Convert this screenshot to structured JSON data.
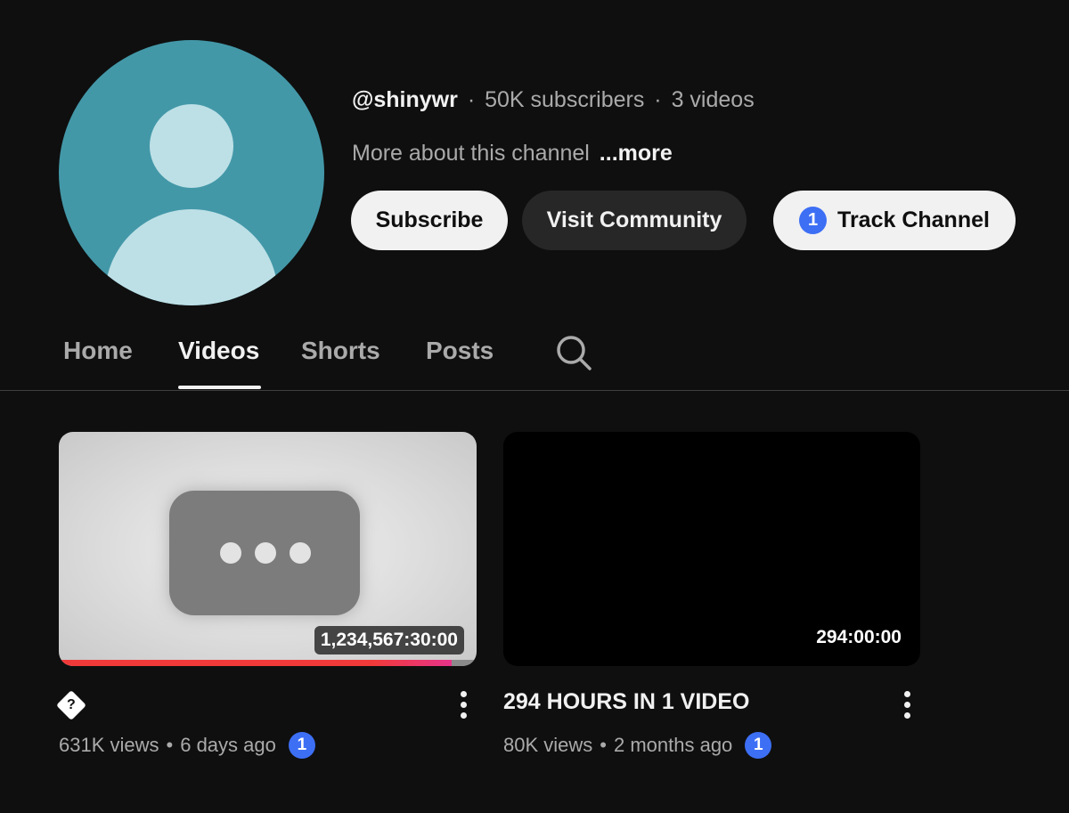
{
  "channel": {
    "handle": "@shinywr",
    "subscribers": "50K subscribers",
    "video_count": "3 videos",
    "separator": "·",
    "about": "More about this channel",
    "more_label": "...more",
    "avatar_color": "#4398a8",
    "avatar_icon": "default-person-avatar"
  },
  "buttons": {
    "subscribe": "Subscribe",
    "community": "Visit Community",
    "track": "Track Channel",
    "track_badge": "1"
  },
  "tabs": [
    {
      "label": "Home",
      "active": false
    },
    {
      "label": "Videos",
      "active": true
    },
    {
      "label": "Shorts",
      "active": false
    },
    {
      "label": "Posts",
      "active": false
    }
  ],
  "search_icon": "search-icon",
  "videos": [
    {
      "title_glyph": "?",
      "duration": "1,234,567:30:00",
      "views": "631K views",
      "age": "6 days ago",
      "badge": "1",
      "watched_fraction": 0.94,
      "thumbnail": "placeholder-ellipsis"
    },
    {
      "title": "294 HOURS IN 1 VIDEO",
      "duration": "294:00:00",
      "views": "80K views",
      "age": "2 months ago",
      "badge": "1",
      "thumbnail": "black"
    }
  ],
  "colors": {
    "background": "#0f0f0f",
    "badge_blue": "#3d6ff5",
    "progress_red": "#f03a3a"
  },
  "meta_separator": "•"
}
